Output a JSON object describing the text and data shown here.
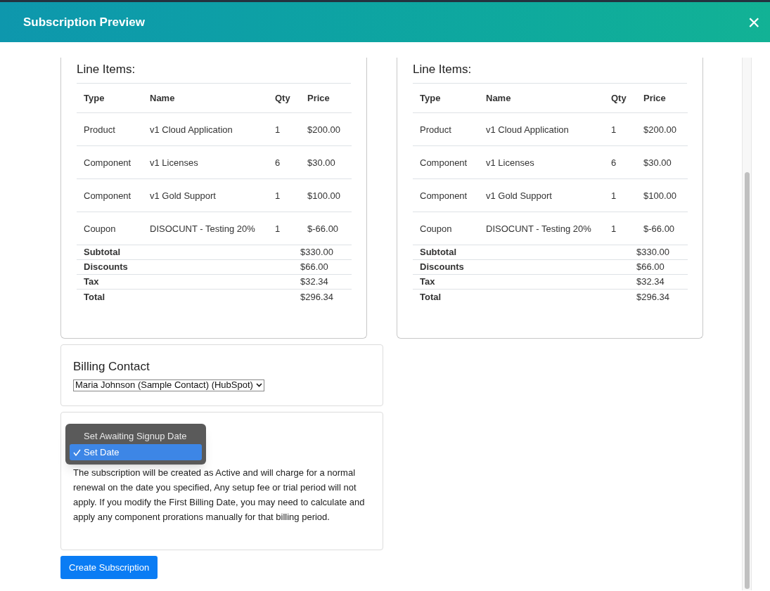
{
  "dialog": {
    "title": "Subscription Preview",
    "close": "×"
  },
  "previews": [
    {
      "heading": "Line Items:",
      "columns": [
        "Type",
        "Name",
        "Qty",
        "Price"
      ],
      "rows": [
        {
          "type": "Product",
          "name": "v1 Cloud Application",
          "qty": "1",
          "price": "$200.00"
        },
        {
          "type": "Component",
          "name": "v1 Licenses",
          "qty": "6",
          "price": "$30.00"
        },
        {
          "type": "Component",
          "name": "v1 Gold Support",
          "qty": "1",
          "price": "$100.00"
        },
        {
          "type": "Coupon",
          "name": "DISOCUNT - Testing 20%",
          "qty": "1",
          "price": "$-66.00"
        }
      ],
      "totals": [
        {
          "label": "Subtotal",
          "value": "$330.00"
        },
        {
          "label": "Discounts",
          "value": "$66.00"
        },
        {
          "label": "Tax",
          "value": "$32.34"
        },
        {
          "label": "Total",
          "value": "$296.34"
        }
      ]
    },
    {
      "heading": "Line Items:",
      "columns": [
        "Type",
        "Name",
        "Qty",
        "Price"
      ],
      "rows": [
        {
          "type": "Product",
          "name": "v1 Cloud Application",
          "qty": "1",
          "price": "$200.00"
        },
        {
          "type": "Component",
          "name": "v1 Licenses",
          "qty": "6",
          "price": "$30.00"
        },
        {
          "type": "Component",
          "name": "v1 Gold Support",
          "qty": "1",
          "price": "$100.00"
        },
        {
          "type": "Coupon",
          "name": "DISOCUNT - Testing 20%",
          "qty": "1",
          "price": "$-66.00"
        }
      ],
      "totals": [
        {
          "label": "Subtotal",
          "value": "$330.00"
        },
        {
          "label": "Discounts",
          "value": "$66.00"
        },
        {
          "label": "Tax",
          "value": "$32.34"
        },
        {
          "label": "Total",
          "value": "$296.34"
        }
      ]
    }
  ],
  "billing_contact": {
    "heading": "Billing Contact",
    "value": "Maria Johnson (Sample Contact) (HubSpot)"
  },
  "billing_date": {
    "options": [
      {
        "label": "Set Awaiting Signup Date",
        "selected": false
      },
      {
        "label": "Set Date",
        "selected": true
      }
    ],
    "description": "The subscription will be created as Active and will charge for a normal renewal on the date you specified, Any setup fee or trial period will not apply. If you modify the First Billing Date, you may need to calculate and apply any component prorations manually for that billing period."
  },
  "create_button": "Create Subscription"
}
